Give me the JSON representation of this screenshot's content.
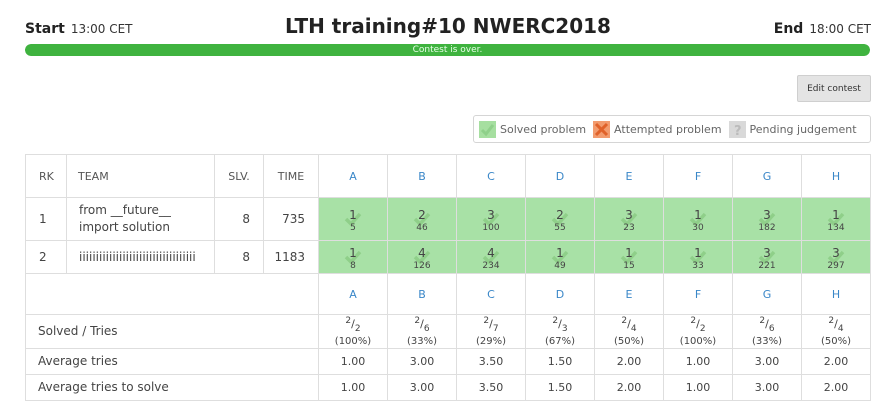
{
  "header": {
    "start_label": "Start",
    "start_time": "13:00 CET",
    "title": "LTH training#10 NWERC2018",
    "end_label": "End",
    "end_time": "18:00 CET"
  },
  "progress": {
    "text": "Contest is over.",
    "fraction": 1.0,
    "color": "#3fb33f"
  },
  "edit_button": "Edit contest",
  "legend": {
    "solved": "Solved problem",
    "attempted": "Attempted problem",
    "pending": "Pending judgement"
  },
  "columns": {
    "rank": "RK",
    "team": "TEAM",
    "solved": "SLV.",
    "time": "TIME"
  },
  "problems": [
    "A",
    "B",
    "C",
    "D",
    "E",
    "F",
    "G",
    "H"
  ],
  "rows": [
    {
      "rank": "1",
      "team_line1": "from __future__",
      "team_line2": "import solution",
      "solved": "8",
      "time": "735",
      "cells": [
        {
          "tries": "1",
          "time": "5"
        },
        {
          "tries": "2",
          "time": "46"
        },
        {
          "tries": "3",
          "time": "100"
        },
        {
          "tries": "2",
          "time": "55"
        },
        {
          "tries": "3",
          "time": "23"
        },
        {
          "tries": "1",
          "time": "30"
        },
        {
          "tries": "3",
          "time": "182"
        },
        {
          "tries": "1",
          "time": "134"
        }
      ]
    },
    {
      "rank": "2",
      "team_line1": "iiiiiiiiiiiiiiiiiiiiiiiiiiiiiiiiiii",
      "team_line2": "",
      "solved": "8",
      "time": "1183",
      "cells": [
        {
          "tries": "1",
          "time": "8"
        },
        {
          "tries": "4",
          "time": "126"
        },
        {
          "tries": "4",
          "time": "234"
        },
        {
          "tries": "1",
          "time": "49"
        },
        {
          "tries": "1",
          "time": "15"
        },
        {
          "tries": "1",
          "time": "33"
        },
        {
          "tries": "3",
          "time": "221"
        },
        {
          "tries": "3",
          "time": "297"
        }
      ]
    }
  ],
  "stats": {
    "solved_tries_label": "Solved / Tries",
    "solved_tries": [
      {
        "num": "2",
        "den": "2",
        "pct": "(100%)"
      },
      {
        "num": "2",
        "den": "6",
        "pct": "(33%)"
      },
      {
        "num": "2",
        "den": "7",
        "pct": "(29%)"
      },
      {
        "num": "2",
        "den": "3",
        "pct": "(67%)"
      },
      {
        "num": "2",
        "den": "4",
        "pct": "(50%)"
      },
      {
        "num": "2",
        "den": "2",
        "pct": "(100%)"
      },
      {
        "num": "2",
        "den": "6",
        "pct": "(33%)"
      },
      {
        "num": "2",
        "den": "4",
        "pct": "(50%)"
      }
    ],
    "avg_tries_label": "Average tries",
    "avg_tries": [
      "1.00",
      "3.00",
      "3.50",
      "1.50",
      "2.00",
      "1.00",
      "3.00",
      "2.00"
    ],
    "avg_tries_solve_label": "Average tries to solve",
    "avg_tries_solve": [
      "1.00",
      "3.00",
      "3.50",
      "1.50",
      "2.00",
      "1.00",
      "3.00",
      "2.00"
    ]
  },
  "colors": {
    "solved_cell": "#a8e1a6",
    "accent_link": "#3a87c8",
    "attempted": "#f29b6e",
    "pending": "#d9d9d9"
  },
  "icons": {
    "solved": "check-icon",
    "attempted": "cross-icon",
    "pending": "question-icon"
  }
}
